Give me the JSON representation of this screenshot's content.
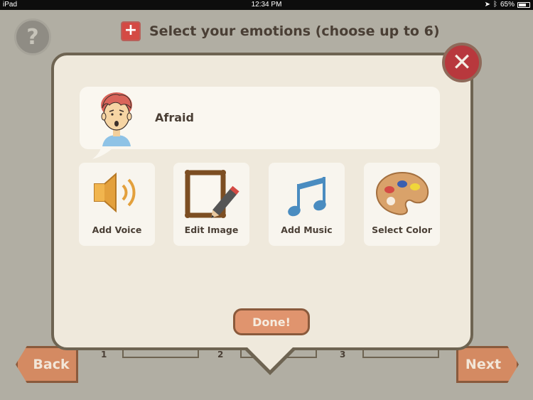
{
  "status_bar": {
    "device": "iPad",
    "time": "12:34 PM",
    "battery": "65%"
  },
  "screen": {
    "help_icon": "question-mark-icon",
    "title": "Select your emotions (choose up to 6)",
    "add_icon": "plus-icon",
    "slot_numbers": [
      "1",
      "2",
      "3"
    ],
    "back_label": "Back",
    "next_label": "Next"
  },
  "modal": {
    "close_icon": "close-icon",
    "emotion": {
      "label": "Afraid",
      "icon": "afraid-face-icon"
    },
    "options": [
      {
        "label": "Add Voice",
        "icon": "speaker-icon"
      },
      {
        "label": "Edit Image",
        "icon": "picture-frame-pencil-icon"
      },
      {
        "label": "Add Music",
        "icon": "music-note-icon"
      },
      {
        "label": "Select Color",
        "icon": "paint-palette-icon"
      }
    ],
    "done_label": "Done!"
  },
  "colors": {
    "background": "#b1aea3",
    "modal": "#efe9dc",
    "accent": "#d48a62",
    "close": "#b8383d"
  }
}
